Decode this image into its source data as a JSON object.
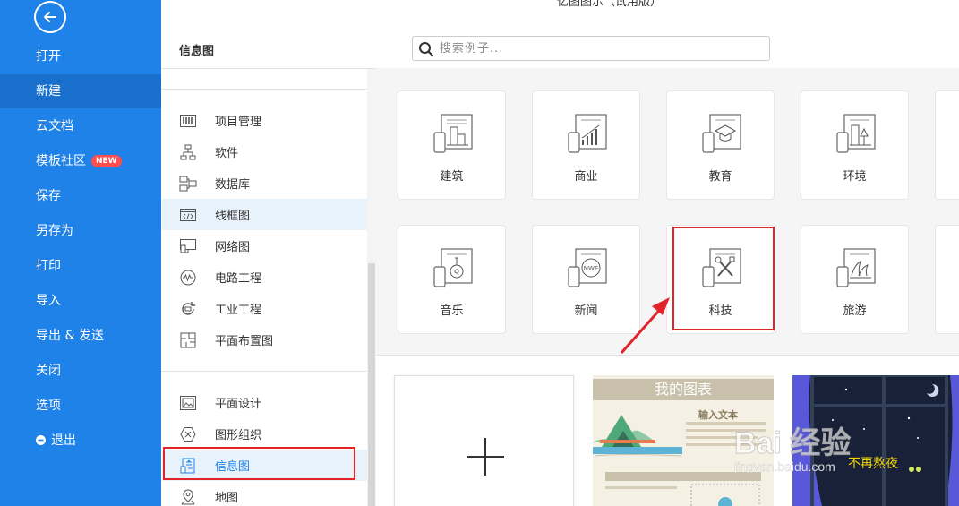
{
  "app": {
    "title": "亿图图示（试用版）"
  },
  "sidebar": {
    "items": [
      {
        "label": "打开"
      },
      {
        "label": "新建"
      },
      {
        "label": "云文档"
      },
      {
        "label": "模板社区",
        "badge": "NEW"
      },
      {
        "label": "保存"
      },
      {
        "label": "另存为"
      },
      {
        "label": "打印"
      },
      {
        "label": "导入"
      },
      {
        "label": "导出 & 发送"
      },
      {
        "label": "关闭"
      },
      {
        "label": "选项"
      },
      {
        "label": "退出"
      }
    ],
    "active": "新建"
  },
  "header": {
    "section_title": "信息图",
    "search_placeholder": "搜索例子..."
  },
  "categories": {
    "group1": [
      {
        "label": "项目管理",
        "icon": "gantt-icon"
      },
      {
        "label": "软件",
        "icon": "hierarchy-icon"
      },
      {
        "label": "数据库",
        "icon": "database-icon"
      },
      {
        "label": "线框图",
        "icon": "code-window-icon"
      },
      {
        "label": "网络图",
        "icon": "network-icon"
      },
      {
        "label": "电路工程",
        "icon": "circuit-icon"
      },
      {
        "label": "工业工程",
        "icon": "process-icon"
      },
      {
        "label": "平面布置图",
        "icon": "floorplan-icon"
      }
    ],
    "group2": [
      {
        "label": "平面设计",
        "icon": "picture-icon"
      },
      {
        "label": "图形组织",
        "icon": "graphic-icon"
      },
      {
        "label": "信息图",
        "icon": "infographic-icon"
      },
      {
        "label": "地图",
        "icon": "map-pin-icon"
      }
    ],
    "selected": "信息图"
  },
  "tiles": [
    {
      "label": "建筑",
      "icon": "building-icon"
    },
    {
      "label": "商业",
      "icon": "chart-icon"
    },
    {
      "label": "教育",
      "icon": "graduation-cap-icon"
    },
    {
      "label": "环境",
      "icon": "tree-icon"
    },
    {
      "label": "音乐",
      "icon": "guitar-icon"
    },
    {
      "label": "新闻",
      "icon": "globe-news-icon"
    },
    {
      "label": "科技",
      "icon": "tools-icon"
    },
    {
      "label": "旅游",
      "icon": "opera-house-icon"
    }
  ],
  "templates": {
    "card1_title": "我的图表",
    "card1_subtitle": "输入文本",
    "card2_text": "不再熬夜"
  },
  "watermark": {
    "brand": "Bai 经验",
    "url": "jingyan.baidu.com"
  },
  "colors": {
    "sidebar": "#1f82e8",
    "highlight": "#e0242a",
    "accent": "#1f82e8"
  }
}
